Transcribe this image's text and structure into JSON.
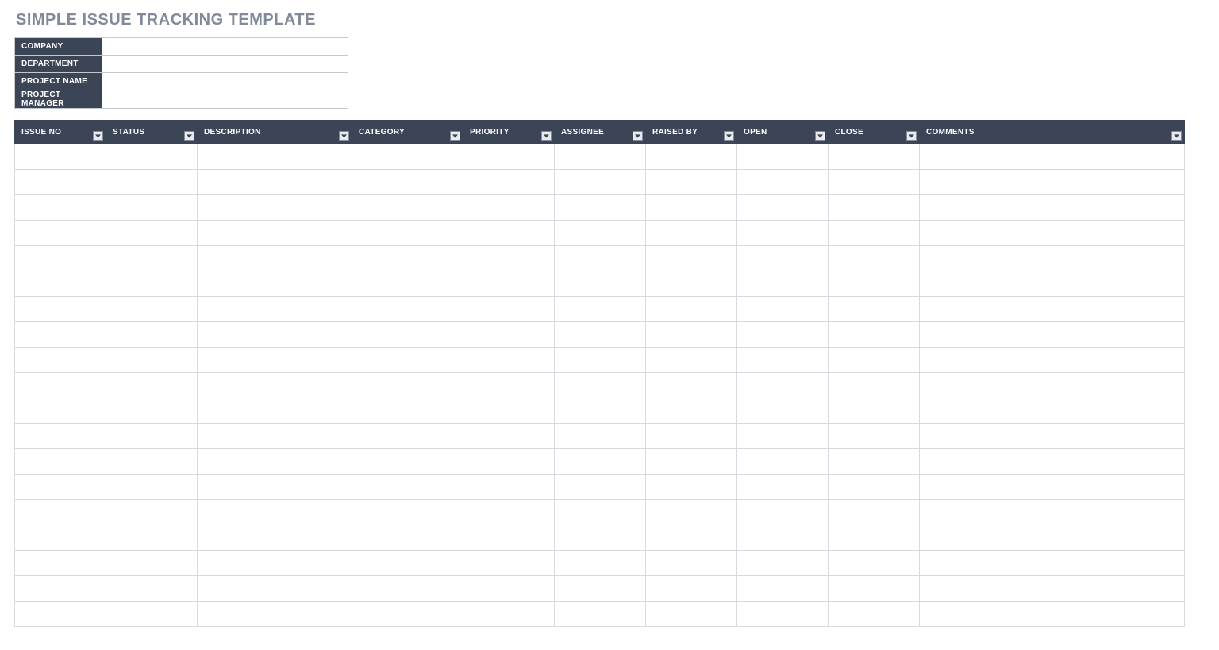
{
  "title": "SIMPLE ISSUE TRACKING TEMPLATE",
  "meta": {
    "rows": [
      {
        "label": "COMPANY",
        "value": ""
      },
      {
        "label": "DEPARTMENT",
        "value": ""
      },
      {
        "label": "PROJECT NAME",
        "value": ""
      },
      {
        "label": "PROJECT MANAGER",
        "value": ""
      }
    ]
  },
  "table": {
    "columns": [
      {
        "key": "issue_no",
        "label": "ISSUE NO",
        "class": "col-issue-no"
      },
      {
        "key": "status",
        "label": "STATUS",
        "class": "col-status"
      },
      {
        "key": "description",
        "label": "DESCRIPTION",
        "class": "col-description"
      },
      {
        "key": "category",
        "label": "CATEGORY",
        "class": "col-category"
      },
      {
        "key": "priority",
        "label": "PRIORITY",
        "class": "col-priority"
      },
      {
        "key": "assignee",
        "label": "ASSIGNEE",
        "class": "col-assignee"
      },
      {
        "key": "raised_by",
        "label": "RAISED BY",
        "class": "col-raised-by"
      },
      {
        "key": "open",
        "label": "OPEN",
        "class": "col-open"
      },
      {
        "key": "close",
        "label": "CLOSE",
        "class": "col-close"
      },
      {
        "key": "comments",
        "label": "COMMENTS",
        "class": "col-comments"
      }
    ],
    "row_count": 19
  }
}
